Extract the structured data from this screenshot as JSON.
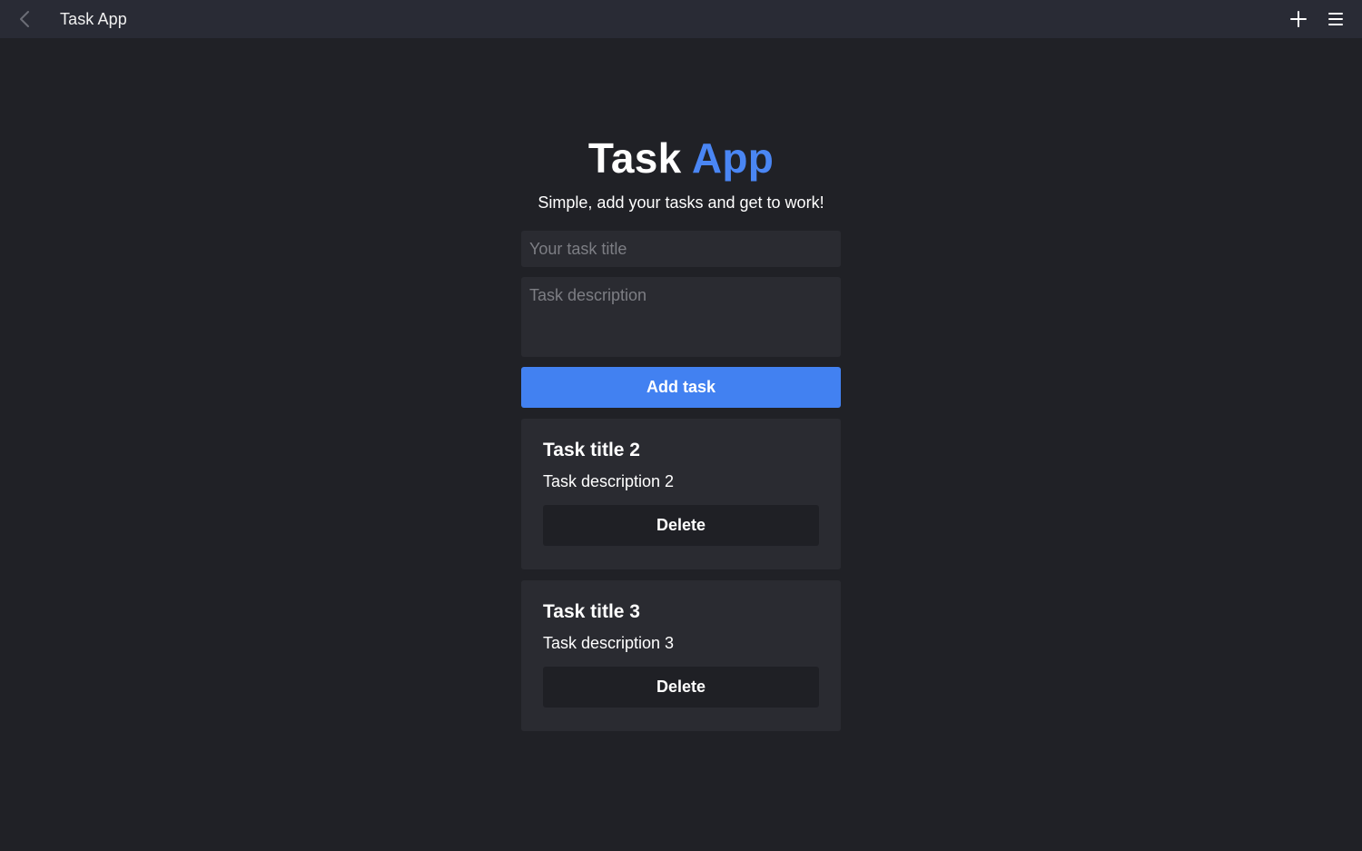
{
  "window": {
    "title": "Task App",
    "back_icon": "chevron-left-icon",
    "add_icon": "plus-icon",
    "menu_icon": "hamburger-menu-icon"
  },
  "header": {
    "title_part1": "Task",
    "title_part2": "App",
    "tagline": "Simple, add your tasks and get to work!"
  },
  "form": {
    "title_placeholder": "Your task title",
    "title_value": "",
    "description_placeholder": "Task description",
    "description_value": "",
    "add_label": "Add task"
  },
  "tasks": [
    {
      "title": "Task title 2",
      "description": "Task description 2",
      "delete_label": "Delete"
    },
    {
      "title": "Task title 3",
      "description": "Task description 3",
      "delete_label": "Delete"
    }
  ],
  "colors": {
    "background": "#202126",
    "titlebar": "#292b35",
    "accent": "#4281f1",
    "card": "#2a2b31",
    "delete_button": "#1f2025"
  }
}
